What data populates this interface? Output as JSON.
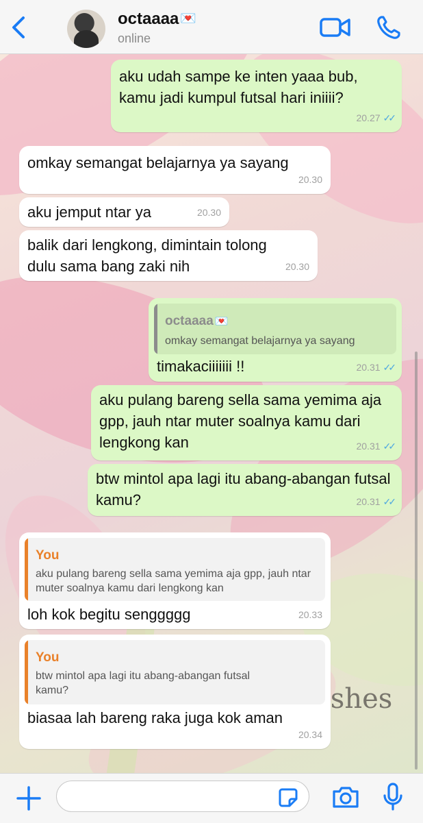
{
  "header": {
    "contact_name": "octaaaa",
    "contact_emoji": "💌",
    "status": "online"
  },
  "colors": {
    "accent": "#1a7cf5",
    "outgoing_bubble": "#dcf8c6",
    "incoming_bubble": "#ffffff",
    "read_ticks": "#4fa8e0",
    "quote_you": "#e9812a",
    "quote_contact_bar": "#8c8c8c"
  },
  "messages": [
    {
      "text": "aku udah sampe ke inten yaaa bub, kamu jadi kumpul futsal hari iniiii?",
      "time": "20.27",
      "ticks": "✓✓"
    },
    {
      "text": "omkay semangat belajarnya ya sayang",
      "time": "20.30"
    },
    {
      "text": "aku jemput ntar ya",
      "time": "20.30"
    },
    {
      "text": "balik dari lengkong, dimintain tolong dulu sama bang zaki nih",
      "time": "20.30"
    },
    {
      "quote_author": "octaaaa",
      "quote_emoji": "💌",
      "quote_text": "omkay semangat belajarnya ya sayang",
      "text": "timakaciiiiiii !!",
      "time": "20.31",
      "ticks": "✓✓"
    },
    {
      "text": "aku pulang bareng sella sama yemima aja gpp, jauh ntar muter soalnya kamu dari lengkong kan",
      "time": "20.31",
      "ticks": "✓✓"
    },
    {
      "text": "btw mintol apa lagi itu abang-abangan futsal kamu?",
      "time": "20.31",
      "ticks": "✓✓"
    },
    {
      "quote_author": "You",
      "quote_text": "aku pulang bareng sella sama yemima aja gpp, jauh ntar muter soalnya kamu dari lengkong kan",
      "text": "loh kok begitu senggggg",
      "time": "20.33"
    },
    {
      "quote_author": "You",
      "quote_text": "btw mintol apa lagi itu abang-abangan futsal kamu?",
      "text": "biasaa lah bareng raka juga kok aman",
      "time": "20.34"
    }
  ],
  "wallpaper_text": "ishes",
  "composer": {
    "value": ""
  }
}
